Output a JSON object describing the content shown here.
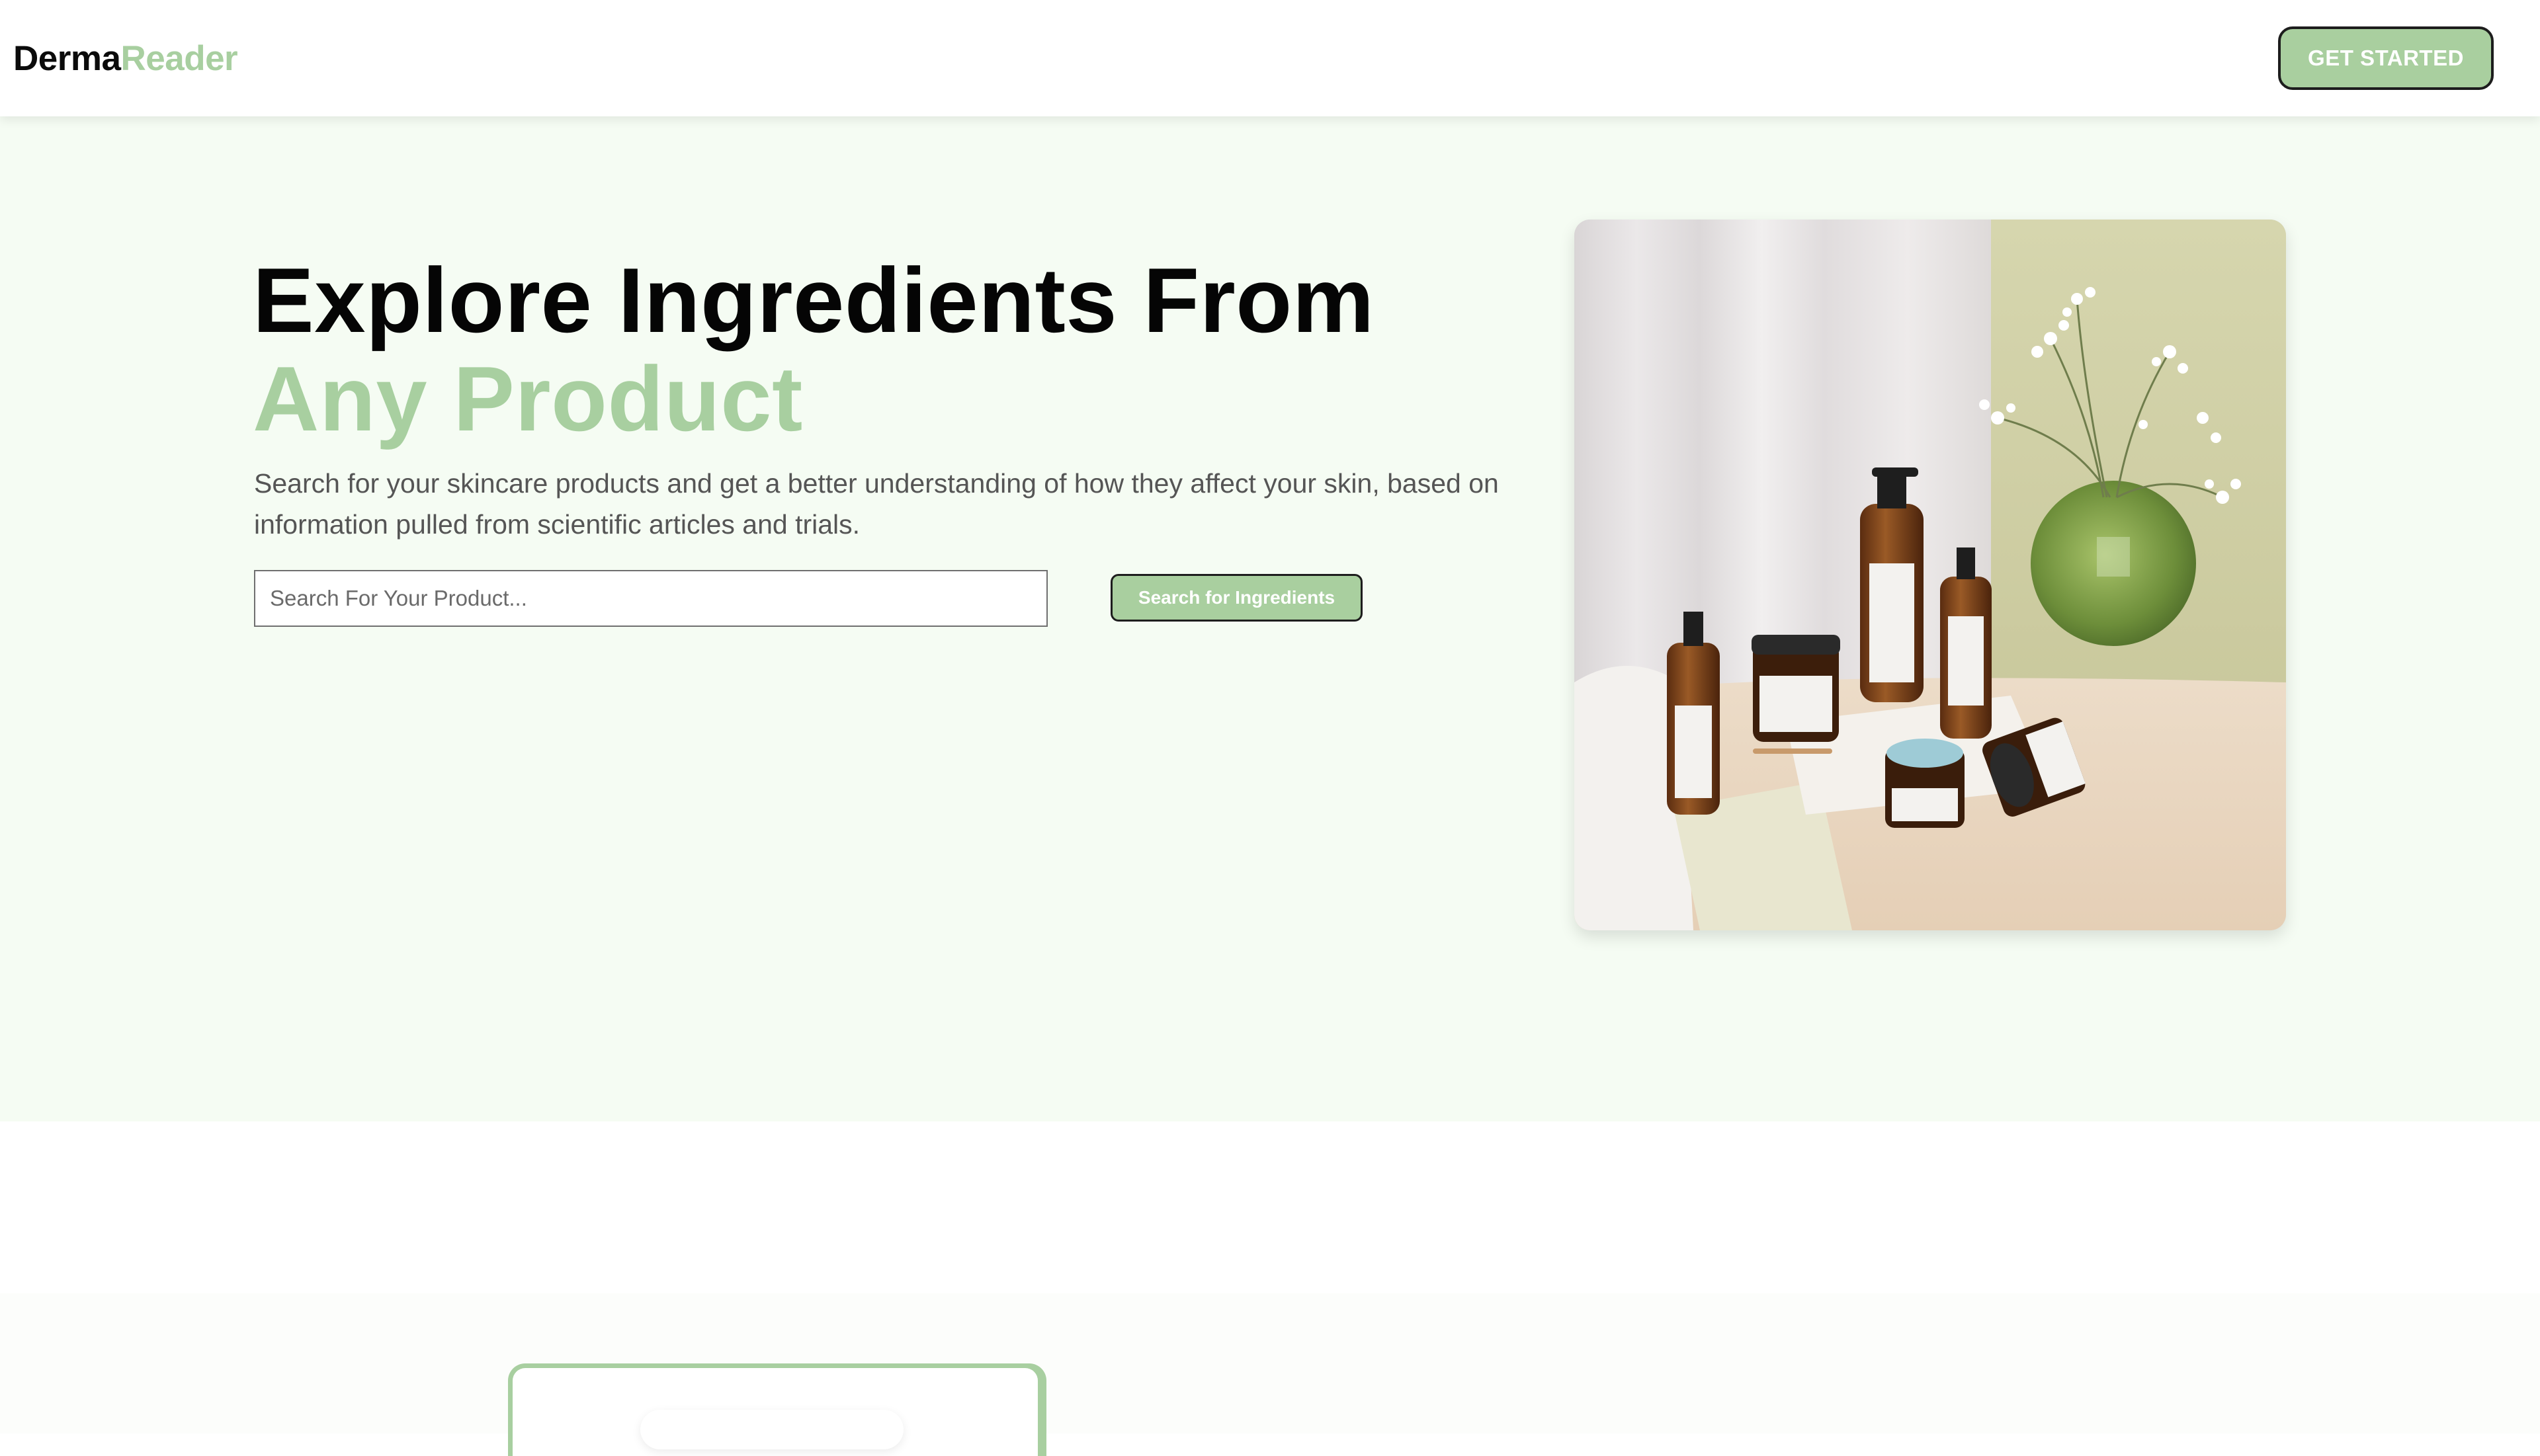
{
  "brand": {
    "name_part1": "Derma",
    "name_part2": "Reader"
  },
  "nav": {
    "cta_label": "GET STARTED"
  },
  "hero": {
    "title_main": "Explore Ingredients From ",
    "title_accent": "Any Product",
    "subtitle": "Search for your skincare products and get a better understanding of how they affect your skin, based on information pulled from scientific articles and trials.",
    "search_placeholder": "Search For Your Product...",
    "search_value": "",
    "search_button_label": "Search for Ingredients"
  },
  "colors": {
    "accent": "#a8cfa0",
    "hero_bg": "#f5fcf3",
    "text_dark": "#050505",
    "text_muted": "#555555"
  }
}
